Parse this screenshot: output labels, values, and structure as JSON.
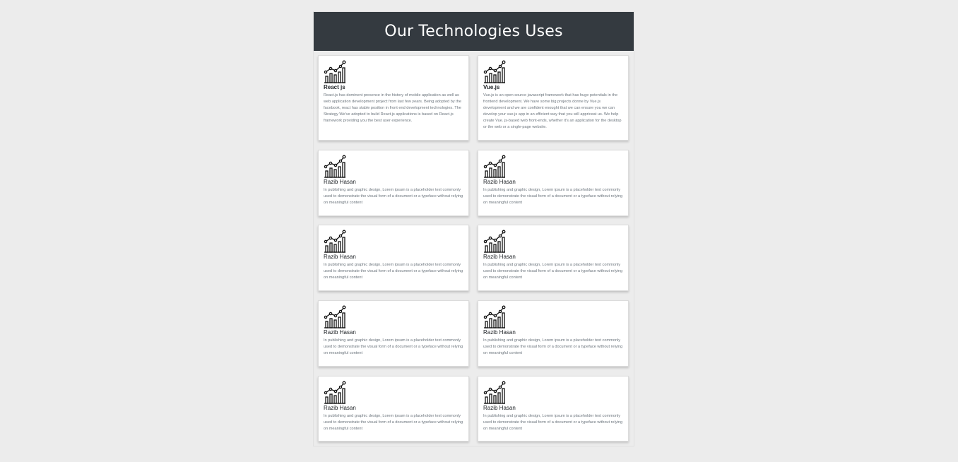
{
  "header": {
    "title": "Our Technologies Uses"
  },
  "cards": [
    {
      "icon": "chart-icon",
      "title": "React js",
      "description": "React.js has dominent presence in the history of mobile application as well as web application development project from last few years. Being adopted by the facebook, react has stable position in front end development technologies. The Strategy We've adopted to build React.js applications is based on React.js framework providing you the best user experience."
    },
    {
      "icon": "chart-icon",
      "title": "Vue.js",
      "description": "Vue.js is an open source javascript framework that has huge potentials in the frontend development. We have some big projects donne by Vue.js development and we are confident enought that we can ensure you we can develop your vue.js app in an efficient way that you will appriceat us. We help create Vue. js-based web front-ends, whether it's an application for the desktop or the web or a single-page website."
    },
    {
      "icon": "chart-icon",
      "title": "Razib Hasan",
      "description": "In publishing and graphic design, Lorem ipsum is a placeholder text commonly used to demonstrate the visual form of a document or a typeface without relying on meaningful content"
    },
    {
      "icon": "chart-icon",
      "title": "Razib Hasan",
      "description": "In publishing and graphic design, Lorem ipsum is a placeholder text commonly used to demonstrate the visual form of a document or a typeface without relying on meaningful content"
    },
    {
      "icon": "chart-icon",
      "title": "Razib Hasan",
      "description": "In publishing and graphic design, Lorem ipsum is a placeholder text commonly used to demonstrate the visual form of a document or a typeface without relying on meaningful content"
    },
    {
      "icon": "chart-icon",
      "title": "Razib Hasan",
      "description": "In publishing and graphic design, Lorem ipsum is a placeholder text commonly used to demonstrate the visual form of a document or a typeface without relying on meaningful content"
    },
    {
      "icon": "chart-icon",
      "title": "Razib Hasan",
      "description": "In publishing and graphic design, Lorem ipsum is a placeholder text commonly used to demonstrate the visual form of a document or a typeface without relying on meaningful content"
    },
    {
      "icon": "chart-icon",
      "title": "Razib Hasan",
      "description": "In publishing and graphic design, Lorem ipsum is a placeholder text commonly used to demonstrate the visual form of a document or a typeface without relying on meaningful content"
    },
    {
      "icon": "chart-icon",
      "title": "Razib Hasan",
      "description": "In publishing and graphic design, Lorem ipsum is a placeholder text commonly used to demonstrate the visual form of a document or a typeface without relying on meaningful content"
    },
    {
      "icon": "chart-icon",
      "title": "Razib Hasan",
      "description": "In publishing and graphic design, Lorem ipsum is a placeholder text commonly used to demonstrate the visual form of a document or a typeface without relying on meaningful content"
    }
  ]
}
